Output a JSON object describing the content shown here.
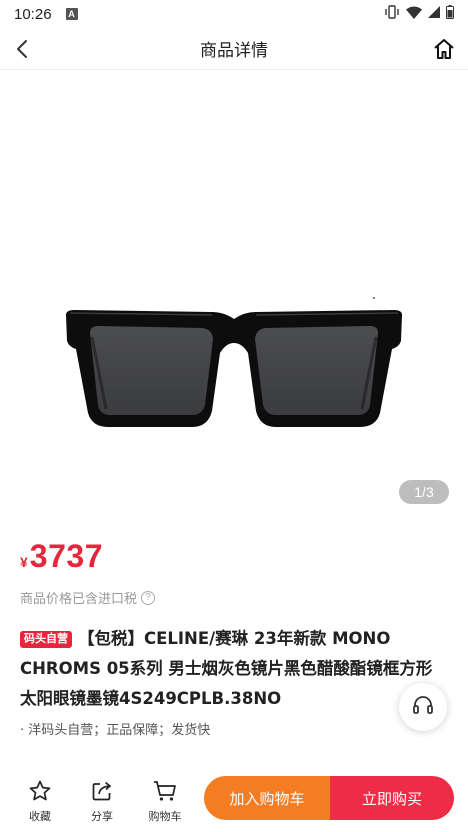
{
  "status_bar": {
    "time": "10:26",
    "notification_icon_letter": "A",
    "icons": [
      "vibrate-icon",
      "wifi-icon",
      "signal-icon",
      "battery-icon"
    ]
  },
  "nav": {
    "title": "商品详情",
    "back_icon": "chevron-left-icon",
    "home_icon": "home-icon"
  },
  "gallery": {
    "image": "sunglasses-product-photo",
    "page_indicator": "1/3",
    "current_page": 1,
    "total_pages": 3
  },
  "price": {
    "symbol": "¥",
    "value": "3737",
    "tax_note": "商品价格已含进口税",
    "help_icon_label": "?"
  },
  "product": {
    "badge": "码头自营",
    "title": "【包税】CELINE/赛琳 23年新款 MONO CHROMS 05系列 男士烟灰色镜片黑色醋酸酯镜框方形太阳眼镜墨镜4S249CPLB.38NO",
    "service_line": "· 洋码头自营；正品保障；发货快"
  },
  "bottom_bar": {
    "favorite_label": "收藏",
    "share_label": "分享",
    "cart_label": "购物车",
    "add_to_cart_label": "加入购物车",
    "buy_now_label": "立即购买"
  },
  "colors": {
    "price_red": "#e5263c",
    "cart_orange": "#f47d24",
    "buy_red": "#ef2c47"
  }
}
